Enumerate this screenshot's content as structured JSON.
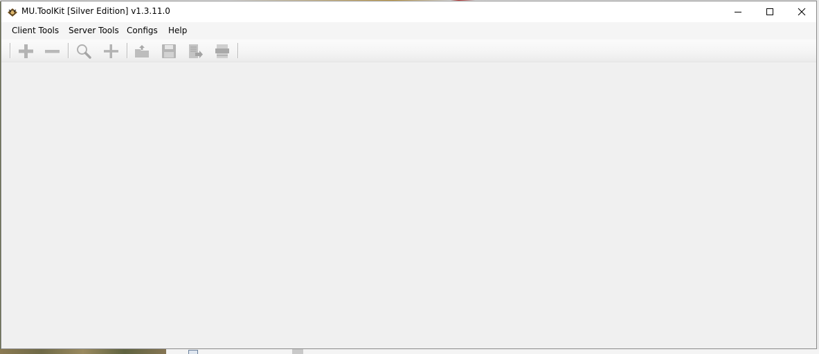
{
  "window": {
    "title": "MU.ToolKit [Silver Edition] v1.3.11.0"
  },
  "menu": {
    "items": [
      "Client Tools",
      "Server Tools",
      "Configs",
      "Help"
    ]
  },
  "toolbar": {
    "buttons": [
      "add-icon",
      "remove-icon",
      "search-icon",
      "add-icon",
      "open-folder-icon",
      "save-icon",
      "export-icon",
      "txt-file-icon"
    ]
  },
  "colors": {
    "window_bg": "#f0f0f0",
    "titlebar_bg": "#ffffff",
    "icon_disabled": "#b5b5b5"
  }
}
